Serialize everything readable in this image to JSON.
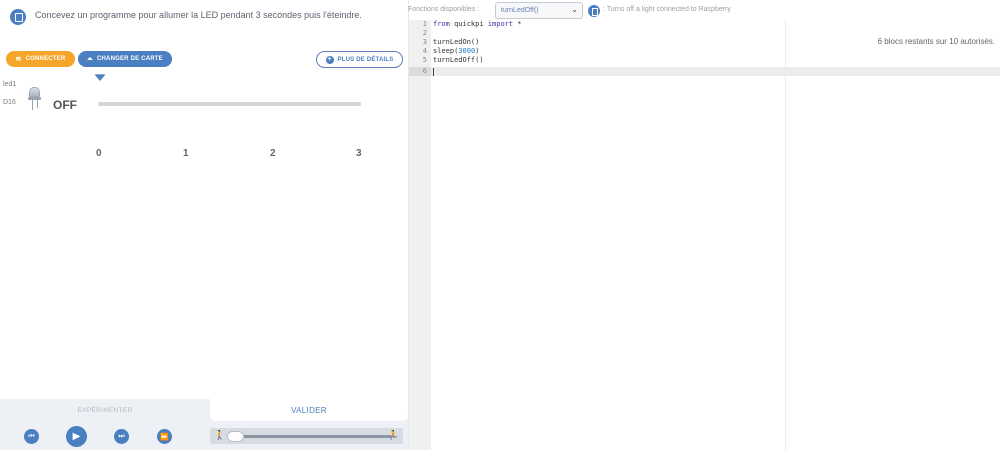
{
  "task": {
    "icon": "task-doc-icon",
    "text": "Concevez un programme pour allumer la LED pendant 3 secondes puis l'éteindre."
  },
  "buttons": {
    "connect": "CONNECTER",
    "change_board": "CHANGER DE CARTE",
    "details": "PLUS DE DÉTAILS"
  },
  "component": {
    "name": "led1",
    "pin": "D16",
    "state": "OFF"
  },
  "timeline": {
    "ticks": [
      "0",
      "1",
      "2",
      "3"
    ]
  },
  "bottom": {
    "tab_experiment": "EXPÉRIMENTER",
    "tab_validate": "VALIDER"
  },
  "functions": {
    "label": "Fonctions disponibles :",
    "selected": "turnLedOff()",
    "description": ": Turns off a light connected to Raspberry"
  },
  "editor": {
    "lines": [
      {
        "n": "1",
        "text": "from quickpi import *"
      },
      {
        "n": "2",
        "text": ""
      },
      {
        "n": "3",
        "text": "turnLedOn()"
      },
      {
        "n": "4",
        "text": "sleep(3000)"
      },
      {
        "n": "5",
        "text": "turnLedOff()"
      },
      {
        "n": "6",
        "text": ""
      }
    ],
    "keywords": [
      "from",
      "import"
    ],
    "number_literal": "3000"
  },
  "status": {
    "blocks_remaining": "6 blocs restants sur 10 autorisés."
  },
  "colors": {
    "accent": "#4a7fc1",
    "connect": "#f4a52a"
  }
}
